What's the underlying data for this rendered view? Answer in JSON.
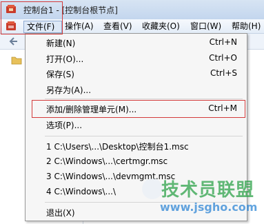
{
  "window": {
    "title": "控制台1 - [控制台根节点]"
  },
  "menubar": {
    "items": [
      {
        "label": "文件(F)"
      },
      {
        "label": "操作(A)"
      },
      {
        "label": "查看(V)"
      },
      {
        "label": "收藏夹(O)"
      },
      {
        "label": "窗口(W)"
      },
      {
        "label": "帮助(H)"
      }
    ]
  },
  "file_menu": {
    "items": [
      {
        "label": "新建(N)",
        "accel": "Ctrl+N"
      },
      {
        "label": "打开(O)...",
        "accel": "Ctrl+O"
      },
      {
        "label": "保存(S)",
        "accel": "Ctrl+S"
      },
      {
        "label": "另存为(A)...",
        "accel": ""
      },
      {
        "label": "添加/删除管理单元(M)...",
        "accel": "Ctrl+M"
      },
      {
        "label": "选项(P)...",
        "accel": ""
      },
      {
        "label": "1 C:\\Users\\...\\Desktop\\控制台1.msc",
        "accel": ""
      },
      {
        "label": "2 C:\\Windows\\...\\certmgr.msc",
        "accel": ""
      },
      {
        "label": "3 C:\\Windows\\...\\devmgmt.msc",
        "accel": ""
      },
      {
        "label": "4 C:\\Windows\\...\\",
        "accel": ""
      },
      {
        "label": "退出(X)",
        "accel": ""
      }
    ]
  },
  "watermark": {
    "title": "技术员联盟",
    "url": "www.jsgho.com"
  },
  "colors": {
    "highlight_outline": "#d33a3a",
    "menu_bg": "#f6f6f6",
    "menubar_active": "#dde8f6"
  },
  "icons": [
    "app-icon",
    "console-doc-icon",
    "back-arrow-icon",
    "folder-icon"
  ]
}
